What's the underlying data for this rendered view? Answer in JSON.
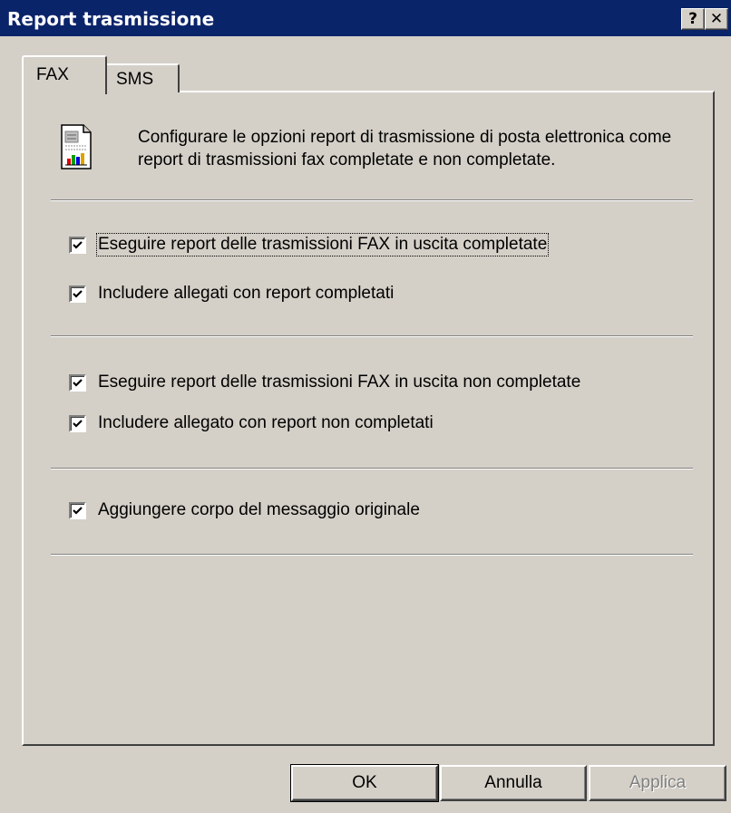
{
  "window": {
    "title": "Report trasmissione",
    "help_glyph": "?",
    "close_glyph": "✕"
  },
  "tabs": [
    {
      "label": "FAX",
      "selected": true
    },
    {
      "label": "SMS",
      "selected": false
    }
  ],
  "description": "Configurare le opzioni report di trasmissione di posta elettronica come report di trasmissioni fax completate e non completate.",
  "options": [
    {
      "label": "Eseguire report delle trasmissioni FAX in uscita completate",
      "checked": true
    },
    {
      "label": "Includere allegati con report completati",
      "checked": true
    },
    {
      "label": "Eseguire report delle trasmissioni FAX in uscita non completate",
      "checked": true
    },
    {
      "label": "Includere allegato con report non completati",
      "checked": true
    },
    {
      "label": "Aggiungere corpo del messaggio originale",
      "checked": true
    }
  ],
  "buttons": {
    "ok": "OK",
    "cancel": "Annulla",
    "apply": "Applica"
  },
  "icons": {
    "report": "report-document-icon",
    "check": "checkmark-icon"
  },
  "colors": {
    "titlebar": "#0a246a",
    "face": "#d4d0c8",
    "disabled_text": "#808080"
  }
}
